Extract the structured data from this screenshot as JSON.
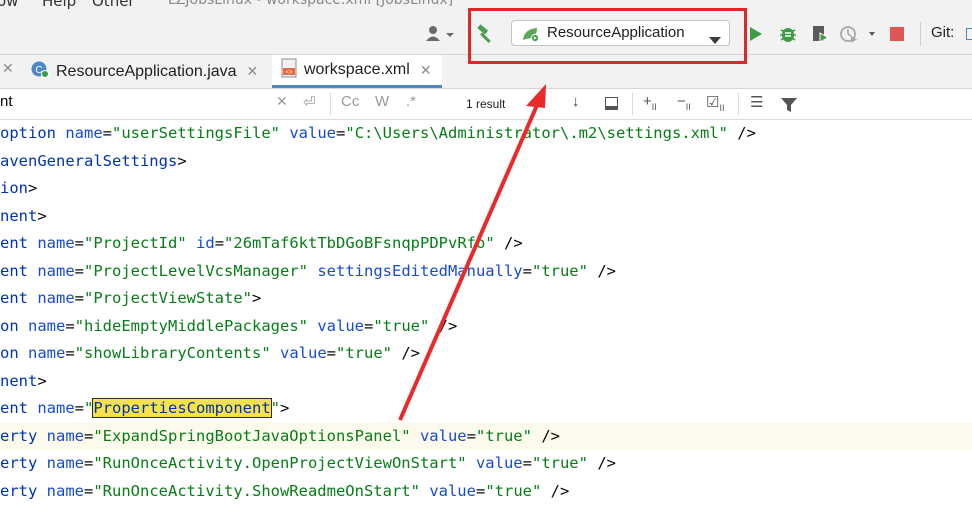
{
  "menu": {
    "items": [
      "ow",
      "Help",
      "Other"
    ],
    "window_title": "LZJobsLinux - workspace.xml [JobsLinux]"
  },
  "toolbar": {
    "run_config": "ResourceApplication",
    "git_label": "Git:",
    "icons": [
      "user-icon",
      "hammer-icon",
      "spring-icon",
      "run-icon",
      "debug-icon",
      "coverage-icon",
      "profile-icon",
      "stop-icon"
    ],
    "colors": {
      "run": "#3d9b44",
      "stop": "#e05555",
      "hammer": "#4b9e4f",
      "highlight": "#e02828"
    }
  },
  "tabs": [
    {
      "label": "ResourceApplication.java",
      "active": false
    },
    {
      "label": "workspace.xml",
      "active": true
    }
  ],
  "search": {
    "value": "nt",
    "result_count": "1 result",
    "options": [
      "Cc",
      "W",
      ".*"
    ]
  },
  "editor": {
    "lines": [
      [
        {
          "t": "option",
          "c": "kw"
        },
        {
          "t": " ",
          "c": "tx"
        },
        {
          "t": "name",
          "c": "an"
        },
        {
          "t": "=",
          "c": "tx"
        },
        {
          "t": "\"userSettingsFile\"",
          "c": "av"
        },
        {
          "t": " ",
          "c": "tx"
        },
        {
          "t": "value",
          "c": "an"
        },
        {
          "t": "=",
          "c": "tx"
        },
        {
          "t": "\"C:\\Users\\Administrator\\.m2\\settings.xml\"",
          "c": "av"
        },
        {
          "t": " />",
          "c": "tx"
        }
      ],
      [
        {
          "t": "avenGeneralSettings",
          "c": "kw"
        },
        {
          "t": ">",
          "c": "tx"
        }
      ],
      [
        {
          "t": "ion",
          "c": "kw"
        },
        {
          "t": ">",
          "c": "tx"
        }
      ],
      [
        {
          "t": "nent",
          "c": "kw"
        },
        {
          "t": ">",
          "c": "tx"
        }
      ],
      [
        {
          "t": "ent",
          "c": "kw"
        },
        {
          "t": " ",
          "c": "tx"
        },
        {
          "t": "name",
          "c": "an"
        },
        {
          "t": "=",
          "c": "tx"
        },
        {
          "t": "\"ProjectId\"",
          "c": "av"
        },
        {
          "t": " ",
          "c": "tx"
        },
        {
          "t": "id",
          "c": "an"
        },
        {
          "t": "=",
          "c": "tx"
        },
        {
          "t": "\"26mTaf6ktTbDGoBFsnqpPDPvRfo\"",
          "c": "av"
        },
        {
          "t": " />",
          "c": "tx"
        }
      ],
      [
        {
          "t": "ent",
          "c": "kw"
        },
        {
          "t": " ",
          "c": "tx"
        },
        {
          "t": "name",
          "c": "an"
        },
        {
          "t": "=",
          "c": "tx"
        },
        {
          "t": "\"ProjectLevelVcsManager\"",
          "c": "av"
        },
        {
          "t": " ",
          "c": "tx"
        },
        {
          "t": "settingsEditedManually",
          "c": "an"
        },
        {
          "t": "=",
          "c": "tx"
        },
        {
          "t": "\"true\"",
          "c": "av"
        },
        {
          "t": " />",
          "c": "tx"
        }
      ],
      [
        {
          "t": "ent",
          "c": "kw"
        },
        {
          "t": " ",
          "c": "tx"
        },
        {
          "t": "name",
          "c": "an"
        },
        {
          "t": "=",
          "c": "tx"
        },
        {
          "t": "\"ProjectViewState\"",
          "c": "av"
        },
        {
          "t": ">",
          "c": "tx"
        }
      ],
      [
        {
          "t": "on",
          "c": "kw"
        },
        {
          "t": " ",
          "c": "tx"
        },
        {
          "t": "name",
          "c": "an"
        },
        {
          "t": "=",
          "c": "tx"
        },
        {
          "t": "\"hideEmptyMiddlePackages\"",
          "c": "av"
        },
        {
          "t": " ",
          "c": "tx"
        },
        {
          "t": "value",
          "c": "an"
        },
        {
          "t": "=",
          "c": "tx"
        },
        {
          "t": "\"true\"",
          "c": "av"
        },
        {
          "t": " />",
          "c": "tx"
        }
      ],
      [
        {
          "t": "on",
          "c": "kw"
        },
        {
          "t": " ",
          "c": "tx"
        },
        {
          "t": "name",
          "c": "an"
        },
        {
          "t": "=",
          "c": "tx"
        },
        {
          "t": "\"showLibraryContents\"",
          "c": "av"
        },
        {
          "t": " ",
          "c": "tx"
        },
        {
          "t": "value",
          "c": "an"
        },
        {
          "t": "=",
          "c": "tx"
        },
        {
          "t": "\"true\"",
          "c": "av"
        },
        {
          "t": " />",
          "c": "tx"
        }
      ],
      [
        {
          "t": "nent",
          "c": "kw"
        },
        {
          "t": ">",
          "c": "tx"
        }
      ],
      [
        {
          "t": "ent",
          "c": "kw"
        },
        {
          "t": " ",
          "c": "tx"
        },
        {
          "t": "name",
          "c": "an"
        },
        {
          "t": "=",
          "c": "tx"
        },
        {
          "t": "\"",
          "c": "av"
        },
        {
          "t": "PropertiesComponent",
          "c": "match"
        },
        {
          "t": "\"",
          "c": "av"
        },
        {
          "t": ">",
          "c": "tx"
        }
      ],
      [
        {
          "t": "erty",
          "c": "kw"
        },
        {
          "t": " ",
          "c": "tx"
        },
        {
          "t": "name",
          "c": "an"
        },
        {
          "t": "=",
          "c": "tx"
        },
        {
          "t": "\"ExpandSpringBootJavaOptionsPanel\"",
          "c": "av"
        },
        {
          "t": " ",
          "c": "tx"
        },
        {
          "t": "value",
          "c": "an"
        },
        {
          "t": "=",
          "c": "tx"
        },
        {
          "t": "\"true\"",
          "c": "av"
        },
        {
          "t": " />",
          "c": "tx"
        }
      ],
      [
        {
          "t": "erty",
          "c": "kw"
        },
        {
          "t": " ",
          "c": "tx"
        },
        {
          "t": "name",
          "c": "an"
        },
        {
          "t": "=",
          "c": "tx"
        },
        {
          "t": "\"RunOnceActivity.OpenProjectViewOnStart\"",
          "c": "av"
        },
        {
          "t": " ",
          "c": "tx"
        },
        {
          "t": "value",
          "c": "an"
        },
        {
          "t": "=",
          "c": "tx"
        },
        {
          "t": "\"true\"",
          "c": "av"
        },
        {
          "t": " />",
          "c": "tx"
        }
      ],
      [
        {
          "t": "erty",
          "c": "kw"
        },
        {
          "t": " ",
          "c": "tx"
        },
        {
          "t": "name",
          "c": "an"
        },
        {
          "t": "=",
          "c": "tx"
        },
        {
          "t": "\"RunOnceActivity.ShowReadmeOnStart\"",
          "c": "av"
        },
        {
          "t": " ",
          "c": "tx"
        },
        {
          "t": "value",
          "c": "an"
        },
        {
          "t": "=",
          "c": "tx"
        },
        {
          "t": "\"true\"",
          "c": "av"
        },
        {
          "t": " />",
          "c": "tx"
        }
      ]
    ],
    "current_line_index": 11
  }
}
